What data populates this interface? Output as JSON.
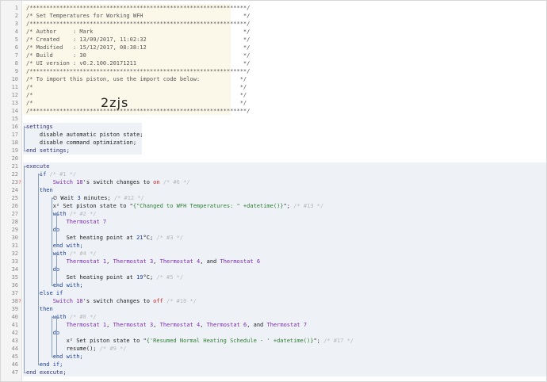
{
  "lines": [
    {
      "n": "1",
      "segs": [
        [
          "cm",
          "/*****************************************************************/"
        ]
      ]
    },
    {
      "n": "2",
      "segs": [
        [
          "cm",
          "/* Set Temperatures for Working WFH                              */"
        ]
      ]
    },
    {
      "n": "3",
      "segs": [
        [
          "cm",
          "/*****************************************************************/"
        ]
      ]
    },
    {
      "n": "4",
      "segs": [
        [
          "cm",
          "/* Author     : Mark                                             */"
        ]
      ]
    },
    {
      "n": "5",
      "segs": [
        [
          "cm",
          "/* Created    : 13/09/2017, 11:02:32                             */"
        ]
      ]
    },
    {
      "n": "6",
      "segs": [
        [
          "cm",
          "/* Modified   : 15/12/2017, 08:38:12                             */"
        ]
      ]
    },
    {
      "n": "7",
      "segs": [
        [
          "cm",
          "/* Build      : 30                                               */"
        ]
      ]
    },
    {
      "n": "8",
      "segs": [
        [
          "cm",
          "/* UI version : v0.2.100.20171211                                */"
        ]
      ]
    },
    {
      "n": "9",
      "segs": [
        [
          "cm",
          "/*****************************************************************/"
        ]
      ]
    },
    {
      "n": "10",
      "segs": [
        [
          "cm",
          "/* To import this piston, use the import code below:            */"
        ]
      ]
    },
    {
      "n": "11",
      "segs": [
        [
          "cm",
          "/*                                                              */"
        ]
      ]
    },
    {
      "n": "12",
      "segs": [
        [
          "cm",
          "/*                                                              */"
        ]
      ]
    },
    {
      "n": "13",
      "segs": [
        [
          "cm",
          "/*                                                              */"
        ]
      ]
    },
    {
      "n": "14",
      "segs": [
        [
          "cm",
          "/*****************************************************************/"
        ]
      ]
    },
    {
      "n": "15",
      "segs": []
    },
    {
      "n": "16",
      "segs": [
        [
          "sb",
          "settings"
        ]
      ]
    },
    {
      "n": "17",
      "segs": [
        [
          "tx",
          "    disable automatic piston state;"
        ]
      ]
    },
    {
      "n": "18",
      "segs": [
        [
          "tx",
          "    disable command optimization;"
        ]
      ]
    },
    {
      "n": "19",
      "segs": [
        [
          "sb",
          "end settings;"
        ]
      ]
    },
    {
      "n": "20",
      "segs": []
    },
    {
      "n": "21",
      "segs": [
        [
          "sb",
          "execute"
        ]
      ]
    },
    {
      "n": "22",
      "segs": [
        [
          "kw",
          "    if "
        ],
        [
          "pid",
          "/* #1 */"
        ]
      ]
    },
    {
      "n": "23",
      "flag": "?",
      "segs": [
        [
          "dv",
          "        Switch 18"
        ],
        [
          "tx",
          "'s switch changes to "
        ],
        [
          "on",
          "on"
        ],
        [
          "pid",
          " /* #6 */"
        ]
      ]
    },
    {
      "n": "24",
      "segs": [
        [
          "kw",
          "    then"
        ]
      ]
    },
    {
      "n": "25",
      "segs": [
        [
          "tx",
          "        ⏲ Wait "
        ],
        [
          "num",
          "3"
        ],
        [
          "tx",
          " minutes; "
        ],
        [
          "pid",
          "/* #12 */"
        ]
      ]
    },
    {
      "n": "26",
      "segs": [
        [
          "tx",
          "        x² Set piston state to \""
        ],
        [
          "str",
          "{\"Changed to WFH Temperatures: \" +datetime()}"
        ],
        [
          "tx",
          "\"; "
        ],
        [
          "pid",
          "/* #13 */"
        ]
      ]
    },
    {
      "n": "27",
      "segs": [
        [
          "kw",
          "        with "
        ],
        [
          "pid",
          "/* #2 */"
        ]
      ]
    },
    {
      "n": "28",
      "segs": [
        [
          "dv",
          "            Thermostat 7"
        ]
      ]
    },
    {
      "n": "29",
      "segs": [
        [
          "kw",
          "        do"
        ]
      ]
    },
    {
      "n": "30",
      "segs": [
        [
          "tx",
          "            Set heating point at "
        ],
        [
          "num",
          "21"
        ],
        [
          "tx",
          "°C; "
        ],
        [
          "pid",
          "/* #3 */"
        ]
      ]
    },
    {
      "n": "31",
      "segs": [
        [
          "kw",
          "        end with;"
        ]
      ]
    },
    {
      "n": "32",
      "segs": [
        [
          "kw",
          "        with "
        ],
        [
          "pid",
          "/* #4 */"
        ]
      ]
    },
    {
      "n": "33",
      "segs": [
        [
          "dv",
          "            Thermostat 1"
        ],
        [
          "tx",
          ", "
        ],
        [
          "dv",
          "Thermostat 3"
        ],
        [
          "tx",
          ", "
        ],
        [
          "dv",
          "Thermostat 4"
        ],
        [
          "tx",
          ", and "
        ],
        [
          "dv",
          "Thermostat 6"
        ]
      ]
    },
    {
      "n": "34",
      "segs": [
        [
          "kw",
          "        do"
        ]
      ]
    },
    {
      "n": "35",
      "segs": [
        [
          "tx",
          "            Set heating point at "
        ],
        [
          "num",
          "19"
        ],
        [
          "tx",
          "°C; "
        ],
        [
          "pid",
          "/* #5 */"
        ]
      ]
    },
    {
      "n": "36",
      "segs": [
        [
          "kw",
          "        end with;"
        ]
      ]
    },
    {
      "n": "37",
      "segs": [
        [
          "kw",
          "    else if"
        ]
      ]
    },
    {
      "n": "38",
      "flag": "?",
      "segs": [
        [
          "dv",
          "        Switch 18"
        ],
        [
          "tx",
          "'s switch changes to "
        ],
        [
          "on",
          "off"
        ],
        [
          "pid",
          " /* #10 */"
        ]
      ]
    },
    {
      "n": "39",
      "segs": [
        [
          "kw",
          "    then"
        ]
      ]
    },
    {
      "n": "40",
      "segs": [
        [
          "kw",
          "        with "
        ],
        [
          "pid",
          "/* #8 */"
        ]
      ]
    },
    {
      "n": "41",
      "segs": [
        [
          "dv",
          "            Thermostat 1"
        ],
        [
          "tx",
          ", "
        ],
        [
          "dv",
          "Thermostat 3"
        ],
        [
          "tx",
          ", "
        ],
        [
          "dv",
          "Thermostat 4"
        ],
        [
          "tx",
          ", "
        ],
        [
          "dv",
          "Thermostat 6"
        ],
        [
          "tx",
          ", and "
        ],
        [
          "dv",
          "Thermostat 7"
        ]
      ]
    },
    {
      "n": "42",
      "segs": [
        [
          "kw",
          "        do"
        ]
      ]
    },
    {
      "n": "43",
      "segs": [
        [
          "tx",
          "            x² Set piston state to \""
        ],
        [
          "str",
          "{'Resumed Normal Heating Schedule - ' +datetime()}"
        ],
        [
          "tx",
          "\"; "
        ],
        [
          "pid",
          "/* #17 */"
        ]
      ]
    },
    {
      "n": "44",
      "segs": [
        [
          "tx",
          "            resume(); "
        ],
        [
          "pid",
          "/* #9 */"
        ]
      ]
    },
    {
      "n": "45",
      "segs": [
        [
          "kw",
          "        end with;"
        ]
      ]
    },
    {
      "n": "46",
      "segs": [
        [
          "kw",
          "    end if;"
        ]
      ]
    },
    {
      "n": "47",
      "segs": [
        [
          "sb",
          "end execute;"
        ]
      ]
    }
  ],
  "import_code": "2zjs"
}
